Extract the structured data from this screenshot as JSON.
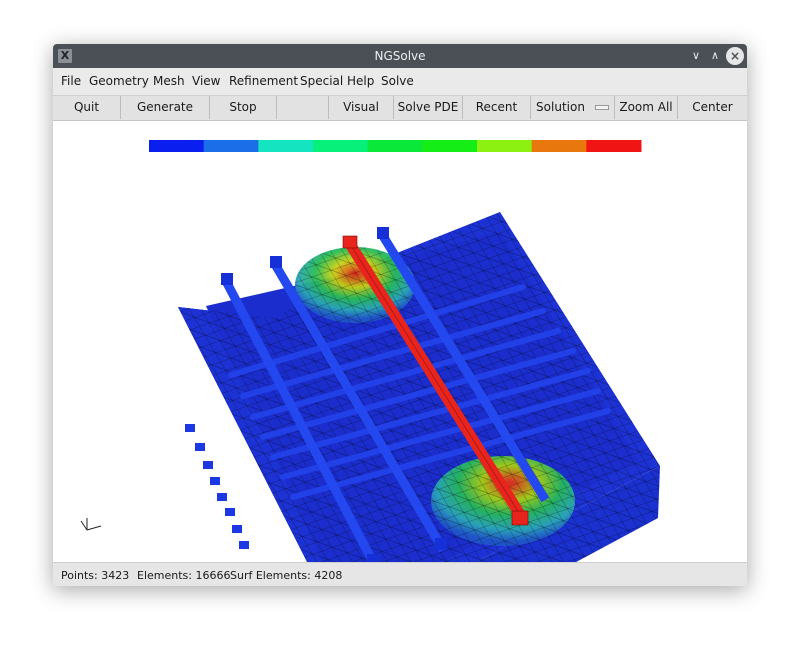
{
  "window": {
    "title": "NGSolve",
    "app_icon_glyph": "X"
  },
  "menu": [
    {
      "label": "File"
    },
    {
      "label": "Geometry"
    },
    {
      "label": "Mesh"
    },
    {
      "label": "View"
    },
    {
      "label": "Refinement"
    },
    {
      "label": "Special"
    },
    {
      "label": "Help"
    },
    {
      "label": "Solve"
    }
  ],
  "toolbar": {
    "quit": "Quit",
    "generate_mesh": "Generate Mesh",
    "stop": "Stop",
    "blank": "",
    "visual": "Visual",
    "solve_pde": "Solve PDE",
    "recent": "Recent",
    "solution": "Solution",
    "zoom_all": "Zoom All",
    "center": "Center"
  },
  "colorbar": {
    "colors": [
      "#0a1ef0",
      "#1c6de8",
      "#14e4c0",
      "#06f07a",
      "#0ae83a",
      "#14ee16",
      "#8cf010",
      "#e8780e",
      "#f01414"
    ]
  },
  "status": {
    "points": "Points: 3423",
    "elements": "Elements: 16666",
    "surf_elements": "Surf Elements: 4208"
  },
  "colors": {
    "mesh_blue": "#1a2fd0",
    "hot_red": "#e8241c",
    "warm_green": "#34c060",
    "cyan": "#2aa7b7",
    "titlebar": "#4a5055"
  }
}
